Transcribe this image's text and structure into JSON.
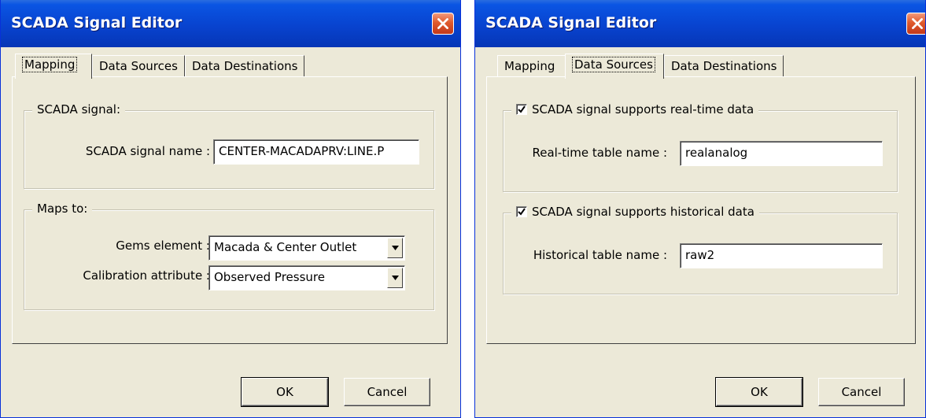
{
  "left_window": {
    "title": "SCADA Signal Editor",
    "active_tab": "Mapping",
    "tabs": [
      {
        "label": "Mapping"
      },
      {
        "label": "Data Sources"
      },
      {
        "label": "Data Destinations"
      }
    ],
    "scada_group": {
      "legend": "SCADA signal:",
      "name_label": "SCADA signal name :",
      "name_value": "CENTER-MACADAPRV:LINE.P"
    },
    "maps_group": {
      "legend": "Maps to:",
      "element_label": "Gems element :",
      "element_value": "Macada & Center Outlet",
      "attribute_label": "Calibration attribute :",
      "attribute_value": "Observed Pressure"
    },
    "ok_label": "OK",
    "cancel_label": "Cancel"
  },
  "right_window": {
    "title": "SCADA Signal Editor",
    "active_tab": "Data Sources",
    "tabs": [
      {
        "label": "Mapping"
      },
      {
        "label": "Data Sources"
      },
      {
        "label": "Data Destinations"
      }
    ],
    "realtime_group": {
      "checkbox_label": "SCADA signal supports real-time data",
      "checked": true,
      "table_label": "Real-time table name :",
      "table_value": "realanalog"
    },
    "historical_group": {
      "checkbox_label": "SCADA signal supports historical data",
      "checked": true,
      "table_label": "Historical table name :",
      "table_value": "raw2"
    },
    "ok_label": "OK",
    "cancel_label": "Cancel"
  },
  "icons": {
    "close": "close-icon",
    "dropdown": "chevron-down-icon",
    "check": "checkmark-icon"
  },
  "colors": {
    "titlebar": "#0843cf",
    "dialog_bg": "#ece9d8",
    "close_button": "#e05a2c"
  }
}
